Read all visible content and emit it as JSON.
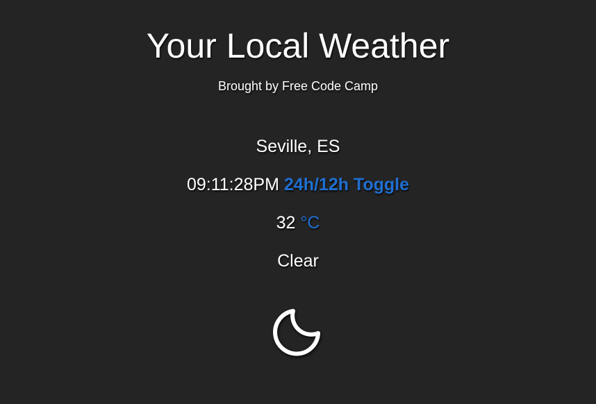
{
  "header": {
    "title": "Your Local Weather",
    "subtitle": "Brought by Free Code Camp"
  },
  "weather": {
    "location": "Seville, ES",
    "time": "09:11:28PM",
    "time_toggle_label": "24h/12h Toggle",
    "temperature": "32",
    "unit_label": "°C",
    "condition": "Clear",
    "icon": "moon-icon"
  },
  "colors": {
    "background": "#252425",
    "text": "#ffffff",
    "accent": "#1f6fd0"
  }
}
